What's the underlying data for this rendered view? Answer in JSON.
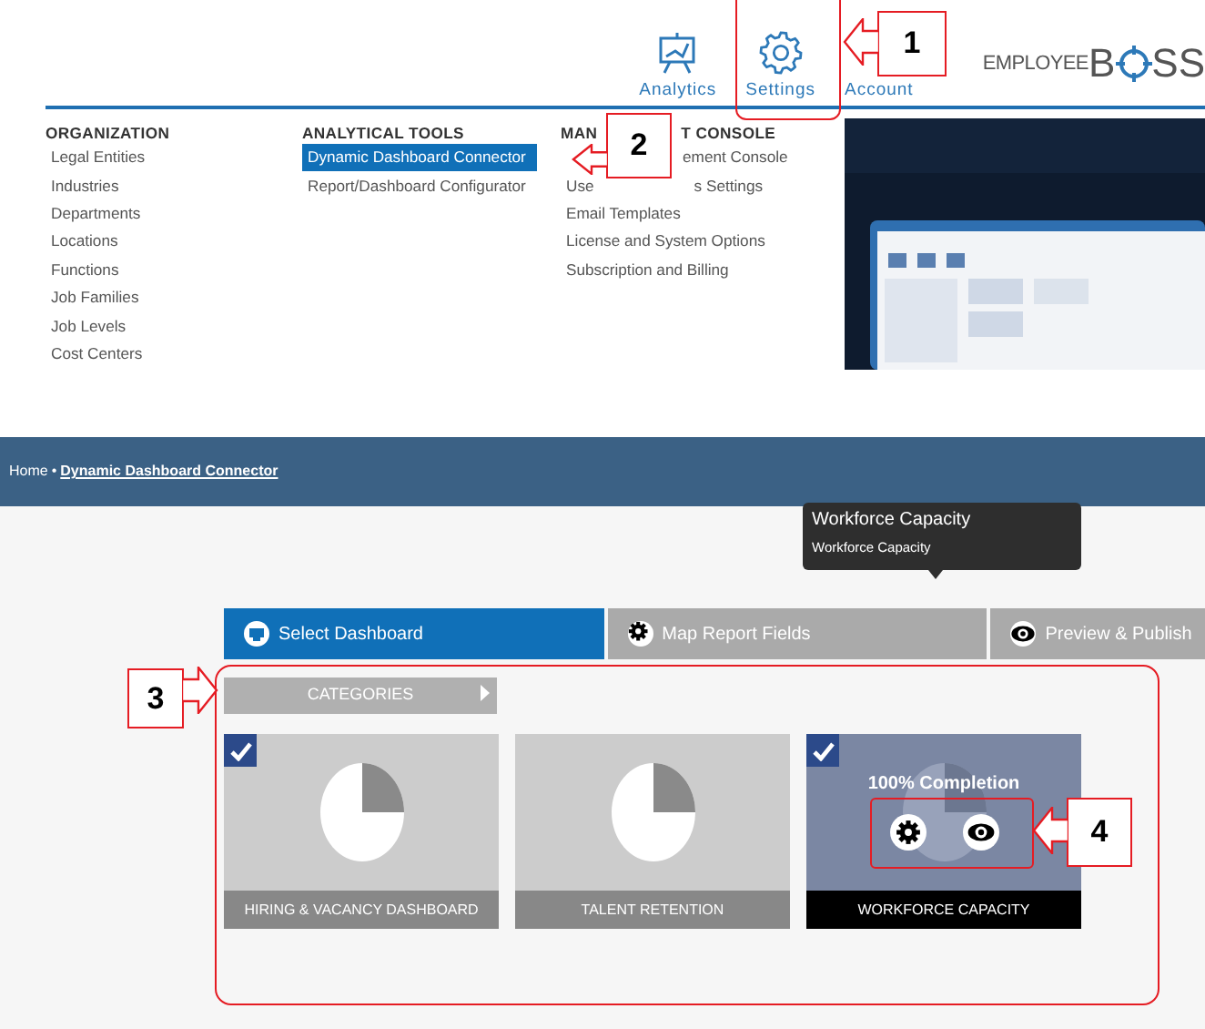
{
  "header": {
    "nav": [
      {
        "label": "Analytics"
      },
      {
        "label": "Settings"
      },
      {
        "label": "Account"
      }
    ],
    "logo": {
      "prefix": "EMPLOYEE",
      "first": "B",
      "last": "SS"
    }
  },
  "menu": {
    "columns": [
      {
        "heading": [
          "ORGANIZATION"
        ],
        "items": [
          {
            "parts": [
              "Legal Entities"
            ],
            "selected": false
          },
          {
            "parts": [
              "Industries"
            ],
            "selected": false
          },
          {
            "parts": [
              "Departments"
            ],
            "selected": false
          },
          {
            "parts": [
              "Locations"
            ],
            "selected": false
          },
          {
            "parts": [
              "Functions"
            ],
            "selected": false
          },
          {
            "parts": [
              "Job Families"
            ],
            "selected": false
          },
          {
            "parts": [
              "Job Levels"
            ],
            "selected": false
          },
          {
            "parts": [
              "Cost Centers"
            ],
            "selected": false
          }
        ]
      },
      {
        "heading": [
          "ANALYTICAL TOOLS"
        ],
        "items": [
          {
            "parts": [
              "Dynamic Dashboard Connector"
            ],
            "selected": true
          },
          {
            "parts": [
              "Report/Dashboard Configurator"
            ],
            "selected": false
          }
        ]
      },
      {
        "heading": [
          "MAN",
          "T CONSOLE"
        ],
        "items": [
          {
            "parts": [
              "ement Console"
            ],
            "covered_start": true,
            "selected": false
          },
          {
            "parts": [
              "Use",
              "s Settings"
            ],
            "selected": false
          },
          {
            "parts": [
              "Email Templates"
            ],
            "selected": false
          },
          {
            "parts": [
              "License and System Options"
            ],
            "selected": false
          },
          {
            "parts": [
              "Subscription and Billing"
            ],
            "selected": false
          }
        ]
      }
    ]
  },
  "breadcrumb": {
    "home": "Home",
    "separator": "•",
    "current": "Dynamic Dashboard Connector"
  },
  "wizard_tabs": [
    {
      "label": "Select Dashboard",
      "selected": true
    },
    {
      "label": "Map Report Fields",
      "selected": false
    },
    {
      "label": "Preview & Publish",
      "selected": false
    }
  ],
  "categories": {
    "label": "CATEGORIES"
  },
  "dashboards": [
    {
      "title": "HIRING & VACANCY DASHBOARD",
      "checked": true,
      "active": false
    },
    {
      "title": "TALENT RETENTION",
      "checked": false,
      "active": false
    },
    {
      "title": "WORKFORCE CAPACITY",
      "checked": true,
      "active": true,
      "completion": "100% Completion"
    }
  ],
  "tooltip": {
    "title": "Workforce Capacity",
    "subtitle": "Workforce Capacity"
  },
  "callouts": [
    {
      "number": "1"
    },
    {
      "number": "2"
    },
    {
      "number": "3"
    },
    {
      "number": "4"
    }
  ]
}
